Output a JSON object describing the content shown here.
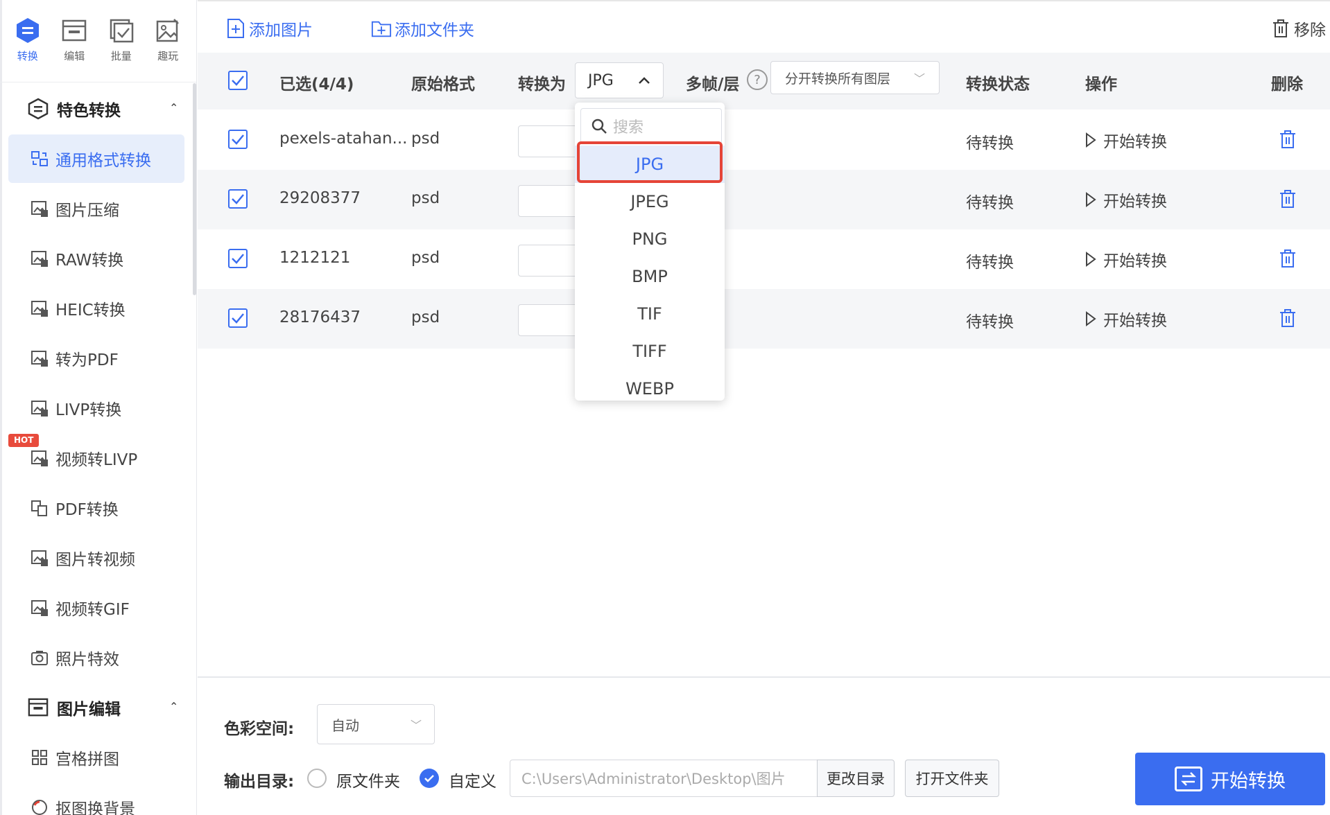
{
  "colors": {
    "accent": "#3a6df0",
    "highlight_ring": "#e54437",
    "hot_badge": "#e84b3c"
  },
  "sidebar": {
    "top_tabs": [
      {
        "label": "转换",
        "icon": "convert-icon",
        "active": true
      },
      {
        "label": "编辑",
        "icon": "edit-icon",
        "active": false
      },
      {
        "label": "批量",
        "icon": "batch-icon",
        "active": false
      },
      {
        "label": "趣玩",
        "icon": "fun-icon",
        "active": false
      }
    ],
    "section1": {
      "title": "特色转换",
      "icon": "special-convert-icon"
    },
    "items": [
      {
        "label": "通用格式转换",
        "icon": "format-icon",
        "active": true
      },
      {
        "label": "图片压缩",
        "icon": "compress-icon"
      },
      {
        "label": "RAW转换",
        "icon": "raw-icon"
      },
      {
        "label": "HEIC转换",
        "icon": "heic-icon"
      },
      {
        "label": "转为PDF",
        "icon": "pdf-icon"
      },
      {
        "label": "LIVP转换",
        "icon": "livp-icon"
      },
      {
        "label": "视频转LIVP",
        "icon": "video-livp-icon"
      },
      {
        "label": "PDF转换",
        "icon": "pdf-convert-icon"
      },
      {
        "label": "图片转视频",
        "icon": "image-video-icon"
      },
      {
        "label": "视频转GIF",
        "icon": "gif-icon"
      },
      {
        "label": "照片特效",
        "icon": "camera-icon"
      }
    ],
    "hot_badge": "HOT",
    "section2": {
      "title": "图片编辑",
      "icon": "image-edit-icon"
    },
    "items2": [
      {
        "label": "宫格拼图",
        "icon": "grid-icon"
      },
      {
        "label": "抠图换背景",
        "icon": "cutout-icon"
      }
    ]
  },
  "toolbar": {
    "add_image": "添加图片",
    "add_folder": "添加文件夹",
    "remove": "移除"
  },
  "table": {
    "headers": {
      "selected": "已选(4/4)",
      "original_format": "原始格式",
      "convert_to": "转换为",
      "multi_frame": "多帧/层",
      "status": "转换状态",
      "action": "操作",
      "delete": "删除"
    },
    "convert_to_value": "JPG",
    "help": "?",
    "layer_option": "分开转换所有图层",
    "rows": [
      {
        "name": "pexels-atahan...",
        "format": "psd",
        "status": "待转换",
        "action": "开始转换"
      },
      {
        "name": "29208377",
        "format": "psd",
        "status": "待转换",
        "action": "开始转换"
      },
      {
        "name": "1212121",
        "format": "psd",
        "status": "待转换",
        "action": "开始转换"
      },
      {
        "name": "28176437",
        "format": "psd",
        "status": "待转换",
        "action": "开始转换"
      }
    ]
  },
  "dropdown": {
    "search_placeholder": "搜索",
    "options": [
      "JPG",
      "JPEG",
      "PNG",
      "BMP",
      "TIF",
      "TIFF",
      "WEBP"
    ],
    "selected": "JPG"
  },
  "bottom": {
    "color_space_label": "色彩空间:",
    "color_space_value": "自动",
    "output_label": "输出目录:",
    "radio_original": "原文件夹",
    "radio_custom": "自定义",
    "custom_selected": true,
    "path": "C:\\Users\\Administrator\\Desktop\\图片",
    "change_dir": "更改目录",
    "open_folder": "打开文件夹",
    "start_all": "开始转换"
  }
}
